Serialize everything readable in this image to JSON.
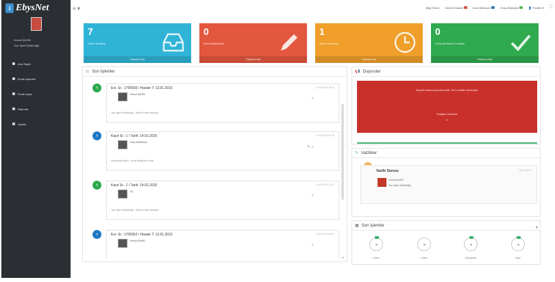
{
  "brand": {
    "logo_mark": "i",
    "name": "EbysNet"
  },
  "user": {
    "name": "Kemal ŞAHİN",
    "role": "Yazı İşleri Müdürlüğü"
  },
  "sidebar": {
    "items": [
      {
        "label": "Ana Sayfa"
      },
      {
        "label": "Evrak İşlemleri"
      },
      {
        "label": "Evrak Arşivi"
      },
      {
        "label": "Raporlar"
      },
      {
        "label": "Ayarlar"
      }
    ]
  },
  "topbar": {
    "links": [
      {
        "label": "Bilgi Paneli",
        "color": ""
      },
      {
        "label": "Gelen Evraklar",
        "color": "#d9534f"
      },
      {
        "label": "İmza Bekleyen",
        "color": "#337ab7"
      },
      {
        "label": "Onay Bekleyen",
        "color": "#5cb85c"
      },
      {
        "label": "Profilim",
        "color": ""
      }
    ]
  },
  "stats": [
    {
      "count": "7",
      "label": "Gelen Evraklar",
      "more": "Tümünü Gör",
      "color": "#2fb4d7",
      "icon": "inbox-icon"
    },
    {
      "count": "0",
      "label": "İmza Bekleyenler",
      "more": "Tümünü Gör",
      "color": "#e4573f",
      "icon": "pencil-icon"
    },
    {
      "count": "1",
      "label": "Süresi Geçenler",
      "more": "Tümünü Gör",
      "color": "#ef9f2a",
      "icon": "clock-icon"
    },
    {
      "count": "0",
      "label": "Onay Bekleyen Evraklar",
      "more": "Tümünü Gör",
      "color": "#2faa4f",
      "icon": "checkmark-icon"
    }
  ],
  "timeline": {
    "title": "Son İşlemler",
    "items": [
      {
        "title": "Evr. Sr.: 1705555 / Havale T: 13.01.2015",
        "date": "13.01.2015 10:24",
        "name": "Kemal ŞAHİN",
        "footer": "Yazı İşleri Müdürlüğü - Gelen Evrak Havalesi",
        "dot": "green",
        "glyph": "‹"
      },
      {
        "title": "Kayıt Sr.: 1 / Tarih: 14.01.2015",
        "date": "14.01.2015 09:15",
        "name": "Eray KARAKAŞ",
        "footer": "Muhasebe Birimi - İmza Bekleyen Evrak",
        "dot": "blue",
        "glyph": "›"
      },
      {
        "title": "Kayıt Sr.: 1 / Tarih: 14.01.2015",
        "date": "14.01.2015 11:02",
        "name": "Ali",
        "footer": "Yazı İşleri Müdürlüğü - Gelen Evrak Havalesi",
        "dot": "green",
        "glyph": "‹"
      },
      {
        "title": "Evr. Sr.: 1705553 / Havale T: 13.01.2015",
        "date": "13.01.2015 08:47",
        "name": "Kemal ŞAHİN",
        "footer": "",
        "dot": "blue",
        "glyph": "›"
      }
    ]
  },
  "announcements": {
    "title": "Duyurular",
    "text": "EbysNet sistemi güncellenmiştir. Yeni modüller eklenmiştir.",
    "sub": "Detayları Görüntüle",
    "dots": "•"
  },
  "tasks": {
    "title": "Vazifeler",
    "name": "Vazife Sorusu",
    "date": "13.01.2015",
    "line1": "Kemal ŞAHİN",
    "line2": "Yazı İşleri Müdürlüğü",
    "glyph": "!"
  },
  "recent": {
    "title": "Son İşlemler",
    "items": [
      {
        "label": "Gelen"
      },
      {
        "label": "Giden"
      },
      {
        "label": "Onaylanan"
      },
      {
        "label": "Arşiv"
      }
    ]
  },
  "colors": {
    "green": "#2faa4f",
    "blue": "#1f7ac3"
  }
}
